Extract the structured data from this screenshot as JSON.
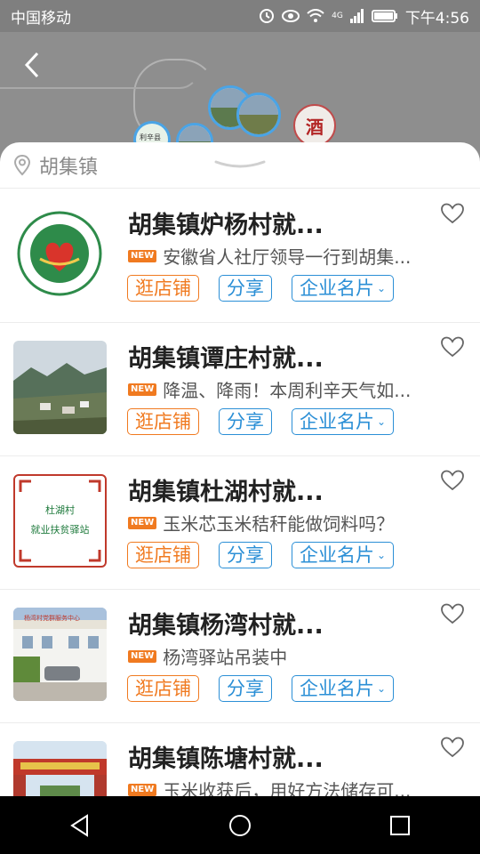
{
  "status": {
    "carrier": "中国移动",
    "signal_label": "4G",
    "time": "下午4:56"
  },
  "map": {
    "liquor_label": "酒",
    "small_pin_label": "利辛县"
  },
  "sheet": {
    "location": "胡集镇"
  },
  "items": [
    {
      "title": "胡集镇炉杨村就...",
      "news": "安徽省人社厅领导一行到胡集...",
      "thumb": "logo"
    },
    {
      "title": "胡集镇谭庄村就...",
      "news": "降温、降雨！本周利辛天气如...",
      "thumb": "landscape"
    },
    {
      "title": "胡集镇杜湖村就...",
      "news": "玉米芯玉米秸秆能做饲料吗？",
      "thumb": "frame",
      "thumb_text1": "杜湖村",
      "thumb_text2": "就业扶贫驿站"
    },
    {
      "title": "胡集镇杨湾村就...",
      "news": "杨湾驿站吊装中",
      "thumb": "building",
      "thumb_banner": "杨湾村党群服务中心"
    },
    {
      "title": "胡集镇陈塘村就...",
      "news": "玉米收获后，用好方法储存可...",
      "thumb": "gate"
    }
  ],
  "labels": {
    "new_badge": "NEW",
    "shop_button": "逛店铺",
    "share_button": "分享",
    "card_button": "企业名片"
  }
}
